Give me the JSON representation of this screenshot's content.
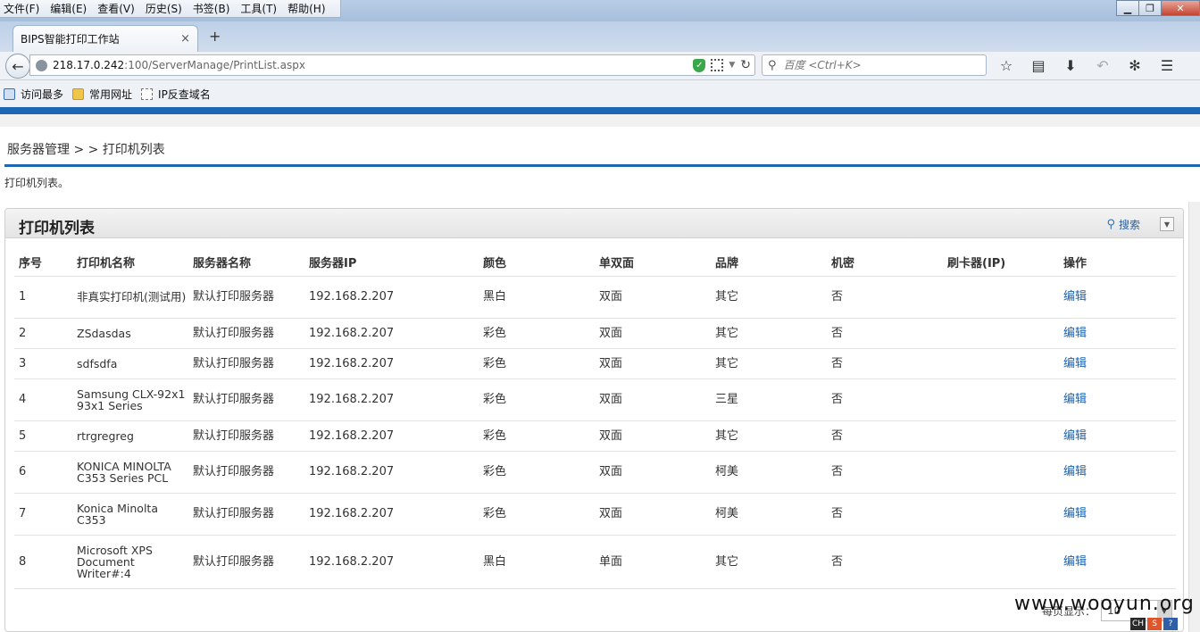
{
  "browser": {
    "menu": [
      "文件(F)",
      "编辑(E)",
      "查看(V)",
      "历史(S)",
      "书签(B)",
      "工具(T)",
      "帮助(H)"
    ],
    "tab_title": "BIPS智能打印工作站",
    "tab_close": "×",
    "new_tab": "+",
    "url_host": "218.17.0.242",
    "url_rest": ":100/ServerManage/PrintList.aspx",
    "search_placeholder": "百度 <Ctrl+K>",
    "bookmarks": [
      "访问最多",
      "常用网址",
      "IP反查域名"
    ],
    "window_buttons": [
      "▁",
      "❐",
      "✕"
    ]
  },
  "page": {
    "breadcrumb": "服务器管理 > > 打印机列表",
    "description": "打印机列表。"
  },
  "panel": {
    "title": "打印机列表",
    "search_label": "搜索",
    "collapse": "▼"
  },
  "table": {
    "headers": [
      "序号",
      "打印机名称",
      "服务器名称",
      "服务器IP",
      "颜色",
      "单双面",
      "品牌",
      "机密",
      "刷卡器(IP)",
      "操作"
    ],
    "rows": [
      {
        "no": "1",
        "name": "非真实打印机(测试用)",
        "server": "默认打印服务器",
        "ip": "192.168.2.207",
        "color": "黑白",
        "duplex": "双面",
        "brand": "其它",
        "secret": "否",
        "reader": "",
        "action": "编辑"
      },
      {
        "no": "2",
        "name": "ZSdasdas",
        "server": "默认打印服务器",
        "ip": "192.168.2.207",
        "color": "彩色",
        "duplex": "双面",
        "brand": "其它",
        "secret": "否",
        "reader": "",
        "action": "编辑"
      },
      {
        "no": "3",
        "name": "sdfsdfa",
        "server": "默认打印服务器",
        "ip": "192.168.2.207",
        "color": "彩色",
        "duplex": "双面",
        "brand": "其它",
        "secret": "否",
        "reader": "",
        "action": "编辑"
      },
      {
        "no": "4",
        "name": "Samsung CLX-92x1 93x1 Series",
        "server": "默认打印服务器",
        "ip": "192.168.2.207",
        "color": "彩色",
        "duplex": "双面",
        "brand": "三星",
        "secret": "否",
        "reader": "",
        "action": "编辑"
      },
      {
        "no": "5",
        "name": "rtrgregreg",
        "server": "默认打印服务器",
        "ip": "192.168.2.207",
        "color": "彩色",
        "duplex": "双面",
        "brand": "其它",
        "secret": "否",
        "reader": "",
        "action": "编辑"
      },
      {
        "no": "6",
        "name": "KONICA MINOLTA C353 Series PCL",
        "server": "默认打印服务器",
        "ip": "192.168.2.207",
        "color": "彩色",
        "duplex": "双面",
        "brand": "柯美",
        "secret": "否",
        "reader": "",
        "action": "编辑"
      },
      {
        "no": "7",
        "name": "Konica Minolta C353",
        "server": "默认打印服务器",
        "ip": "192.168.2.207",
        "color": "彩色",
        "duplex": "双面",
        "brand": "柯美",
        "secret": "否",
        "reader": "",
        "action": "编辑"
      },
      {
        "no": "8",
        "name": "Microsoft XPS Document Writer#:4",
        "server": "默认打印服务器",
        "ip": "192.168.2.207",
        "color": "黑白",
        "duplex": "单面",
        "brand": "其它",
        "secret": "否",
        "reader": "",
        "action": "编辑"
      }
    ]
  },
  "pager": {
    "per_page_label": "每页显示：",
    "per_page_value": "10"
  },
  "watermark": "www.wooyun.org",
  "tray": [
    "CH",
    "S",
    "?"
  ],
  "colors": {
    "accent_blue": "#1d66b3",
    "link": "#1d62ad"
  }
}
